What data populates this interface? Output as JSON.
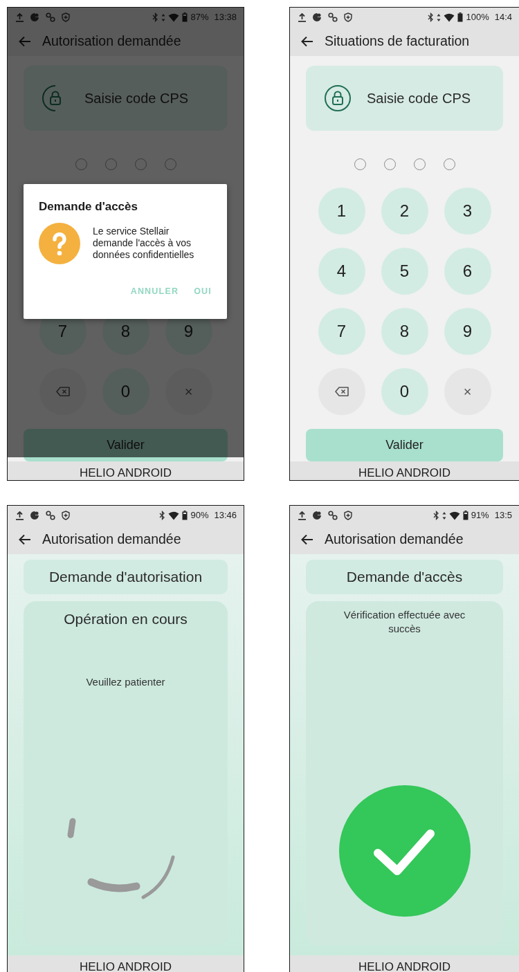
{
  "screens": [
    {
      "kind": "pin",
      "status_bar": {
        "battery": "87%",
        "time": "13:38",
        "data_arrows": true,
        "battery_full": false
      },
      "app_bar": {
        "title": "Autorisation demandée"
      },
      "title_card": {
        "label": "Saisie code CPS",
        "loading": true
      },
      "pin_dots": [
        {
          "filled": false
        },
        {
          "filled": false
        },
        {
          "filled": false
        },
        {
          "filled": false
        }
      ],
      "keys": [
        {
          "kind": "digit",
          "label": "7"
        },
        {
          "kind": "digit",
          "label": "8"
        },
        {
          "kind": "digit",
          "label": "9"
        },
        {
          "kind": "backspace"
        },
        {
          "kind": "digit",
          "label": "0"
        },
        {
          "kind": "clear",
          "label": "×"
        }
      ],
      "submit": {
        "label": "Valider"
      },
      "dialog": {
        "title": "Demande d'accès",
        "message": "Le service Stellair demande l'accès à vos données confidentielles",
        "buttons": [
          "ANNULER",
          "OUI"
        ]
      },
      "footer": "HELIO ANDROID"
    },
    {
      "kind": "pin",
      "status_bar": {
        "battery": "100%",
        "time": "14:4",
        "data_arrows": true,
        "battery_full": true
      },
      "app_bar": {
        "title": "Situations de facturation"
      },
      "title_card": {
        "label": "Saisie code CPS",
        "loading": false
      },
      "pin_dots": [
        {
          "filled": false
        },
        {
          "filled": false
        },
        {
          "filled": false
        },
        {
          "filled": false
        }
      ],
      "keys": [
        {
          "kind": "digit",
          "label": "1"
        },
        {
          "kind": "digit",
          "label": "2"
        },
        {
          "kind": "digit",
          "label": "3"
        },
        {
          "kind": "digit",
          "label": "4"
        },
        {
          "kind": "digit",
          "label": "5"
        },
        {
          "kind": "digit",
          "label": "6"
        },
        {
          "kind": "digit",
          "label": "7"
        },
        {
          "kind": "digit",
          "label": "8"
        },
        {
          "kind": "digit",
          "label": "9"
        },
        {
          "kind": "backspace"
        },
        {
          "kind": "digit",
          "label": "0"
        },
        {
          "kind": "clear",
          "label": "×"
        }
      ],
      "submit": {
        "label": "Valider"
      },
      "footer": "HELIO ANDROID"
    },
    {
      "kind": "progress",
      "status_bar": {
        "battery": "90%",
        "time": "13:46",
        "data_arrows": false,
        "battery_full": false
      },
      "app_bar": {
        "title": "Autorisation demandée"
      },
      "header": "Demande d'autorisation",
      "card": {
        "title": "Opération en cours",
        "message": "Veuillez patienter"
      },
      "footer": "HELIO ANDROID"
    },
    {
      "kind": "success",
      "status_bar": {
        "battery": "91%",
        "time": "13:5",
        "data_arrows": true,
        "battery_full": false
      },
      "app_bar": {
        "title": "Autorisation demandée"
      },
      "header": "Demande d'accès",
      "card": {
        "message": "Vérification effectuée avec succès"
      },
      "footer": "HELIO ANDROID"
    }
  ]
}
